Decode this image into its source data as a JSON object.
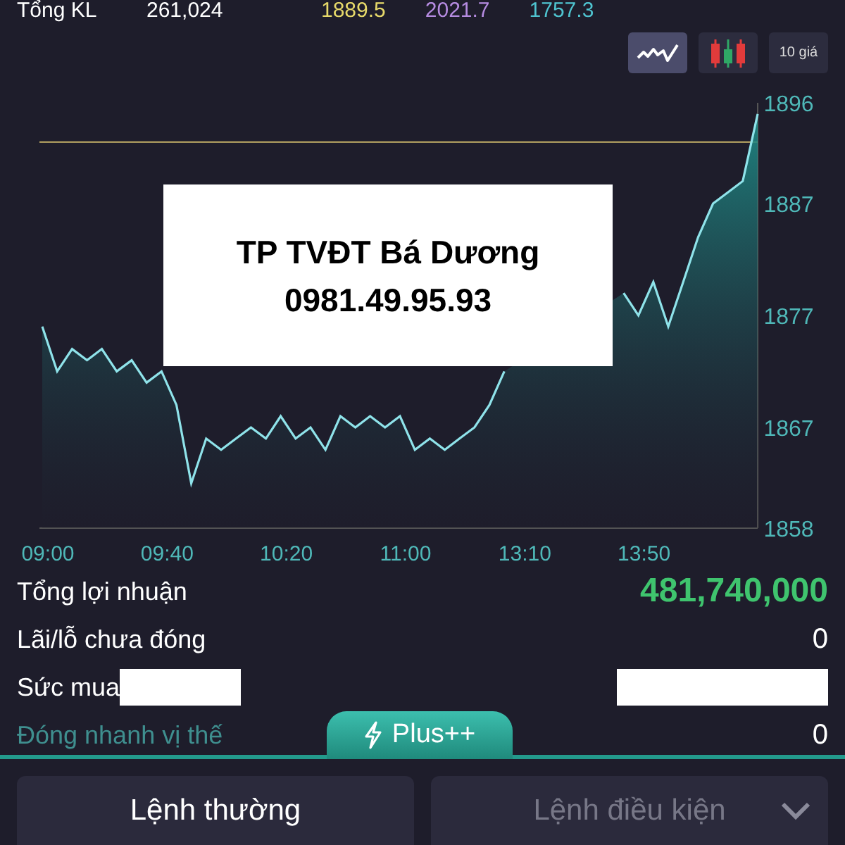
{
  "summary": {
    "label": "Tổng KL",
    "volume": "261,024",
    "prices": [
      {
        "value": "1889.5",
        "color": "#e6d96a"
      },
      {
        "value": "2021.7",
        "color": "#b58be0"
      },
      {
        "value": "1757.3",
        "color": "#4fc4d0"
      }
    ]
  },
  "chart_toggles": [
    {
      "kind": "line",
      "selected": true
    },
    {
      "kind": "candle",
      "selected": false
    },
    {
      "kind": "text",
      "label": "10 giá",
      "selected": false
    }
  ],
  "chart": {
    "chart_data": {
      "type": "area",
      "categories": [
        "09:00",
        null,
        null,
        null,
        null,
        null,
        null,
        null,
        "09:40",
        null,
        null,
        null,
        null,
        null,
        null,
        null,
        "10:20",
        null,
        null,
        null,
        null,
        null,
        null,
        null,
        "11:00",
        null,
        null,
        null,
        null,
        null,
        null,
        null,
        "13:10",
        null,
        null,
        null,
        null,
        null,
        null,
        null,
        "13:50",
        null,
        null,
        null,
        null,
        null,
        null,
        null,
        null
      ],
      "series": [
        {
          "color": "#8fe3ea",
          "values": [
            1876,
            1872,
            1874,
            1873,
            1874,
            1872,
            1873,
            1871,
            1872,
            1869,
            1862,
            1866,
            1865,
            1866,
            1867,
            1866,
            1868,
            1866,
            1867,
            1865,
            1868,
            1867,
            1868,
            1867,
            1868,
            1865,
            1866,
            1865,
            1866,
            1867,
            1869,
            1872,
            null,
            null,
            null,
            null,
            null,
            null,
            null,
            1879,
            1877,
            1880,
            1876,
            1880,
            1884,
            1887,
            1888,
            1889,
            1895
          ]
        }
      ],
      "ylim": [
        1858,
        1896
      ],
      "yticks": [
        1858,
        1867,
        1877,
        1887,
        1896
      ],
      "ref_lines": [
        {
          "axis": "y",
          "value": 1892.5,
          "color": "#c9b46a"
        }
      ]
    },
    "overlay_note": [
      "TP TVĐT Bá Dương",
      "0981.49.95.93"
    ]
  },
  "stats": [
    {
      "label": "Tổng lợi nhuận",
      "value": "481,740,000",
      "kind": "profit"
    },
    {
      "label": "Lãi/lỗ chưa đóng",
      "value": "0",
      "kind": "plain"
    },
    {
      "label": "Sức mua",
      "kind": "redacted"
    },
    {
      "label": "Đóng nhanh vị thế",
      "value": "0",
      "kind": "link"
    }
  ],
  "plus_tab": {
    "label": "Plus++"
  },
  "order_tabs": [
    {
      "label": "Lệnh thường",
      "selected": true
    },
    {
      "label": "Lệnh điều kiện",
      "selected": false,
      "dropdown": true
    }
  ]
}
